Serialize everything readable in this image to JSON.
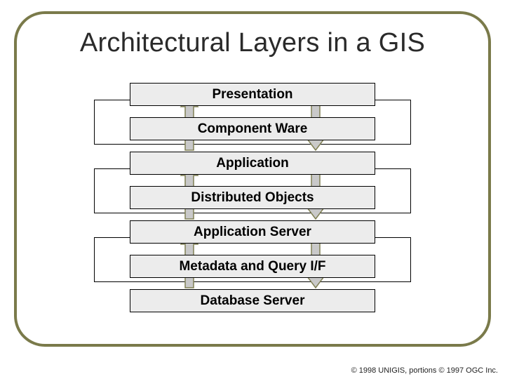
{
  "title": "Architectural Layers in a GIS",
  "layers": [
    "Presentation",
    "Component Ware",
    "Application",
    "Distributed Objects",
    "Application Server",
    "Metadata and Query I/F",
    "Database Server"
  ],
  "arrow_pairs": [
    {
      "from": 0,
      "to": 2
    },
    {
      "from": 2,
      "to": 4
    },
    {
      "from": 4,
      "to": 6
    }
  ],
  "colors": {
    "frame": "#7a7a4a",
    "box_fill": "#ececec",
    "arrow_fill": "#c9c9c9"
  },
  "footer": "© 1998 UNIGIS, portions © 1997 OGC Inc."
}
